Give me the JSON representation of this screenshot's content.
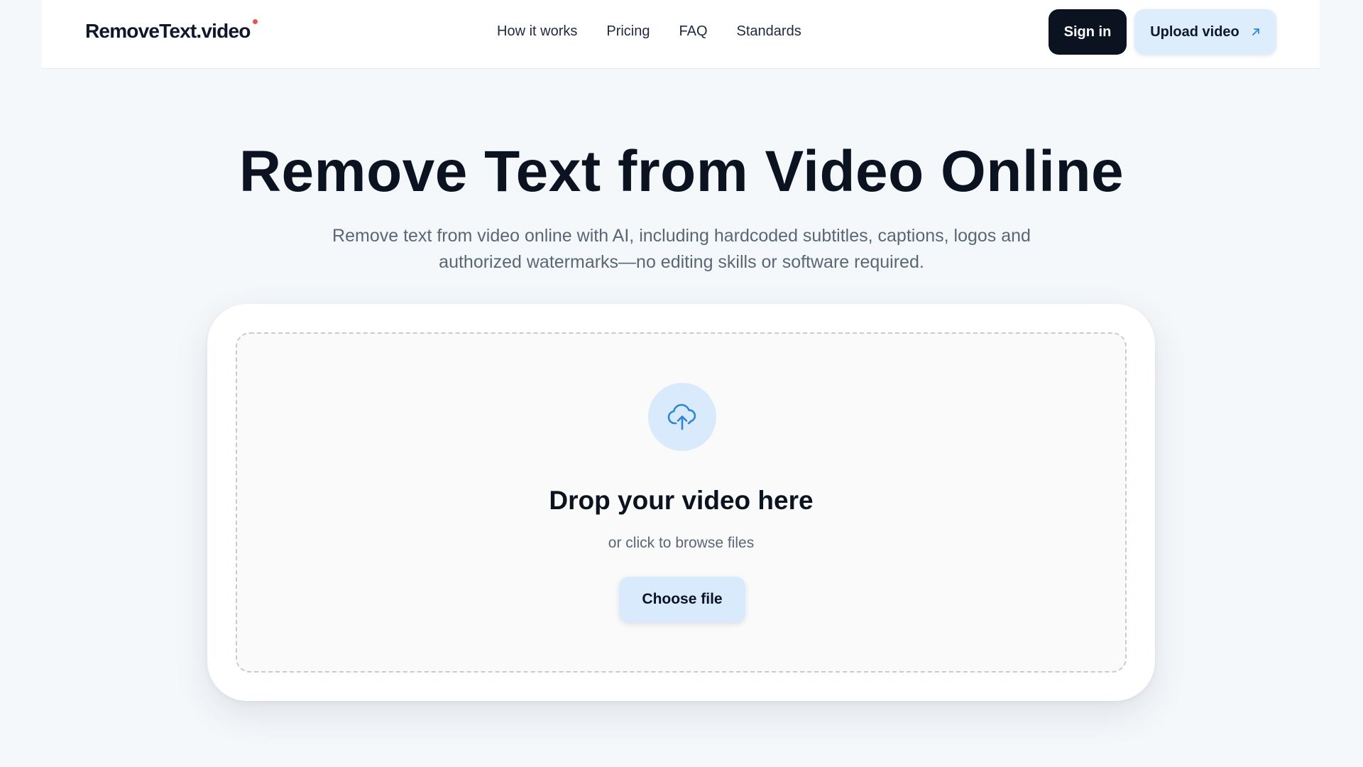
{
  "brand": {
    "name": "RemoveText.video",
    "dot_color": "#e4574b"
  },
  "nav": {
    "items": [
      {
        "label": "How it works"
      },
      {
        "label": "Pricing"
      },
      {
        "label": "FAQ"
      },
      {
        "label": "Standards"
      }
    ]
  },
  "header": {
    "signin_label": "Sign in",
    "upload_label": "Upload video",
    "upload_icon": "arrow-up-right-icon"
  },
  "hero": {
    "title": "Remove Text from Video Online",
    "subtitle_line1": "Remove text from video online with AI, including hardcoded subtitles, captions, logos and",
    "subtitle_line2": "authorized watermarks—no editing skills or software required."
  },
  "uploader": {
    "icon": "cloud-upload-icon",
    "title": "Drop your video here",
    "subtitle": "or click to browse files",
    "button_label": "Choose file"
  },
  "colors": {
    "background": "#f5f8fb",
    "accent_light": "#d8eafb",
    "accent_icon": "#2f86d6",
    "dark_button": "#0b1220",
    "muted_text": "#5b6675"
  }
}
